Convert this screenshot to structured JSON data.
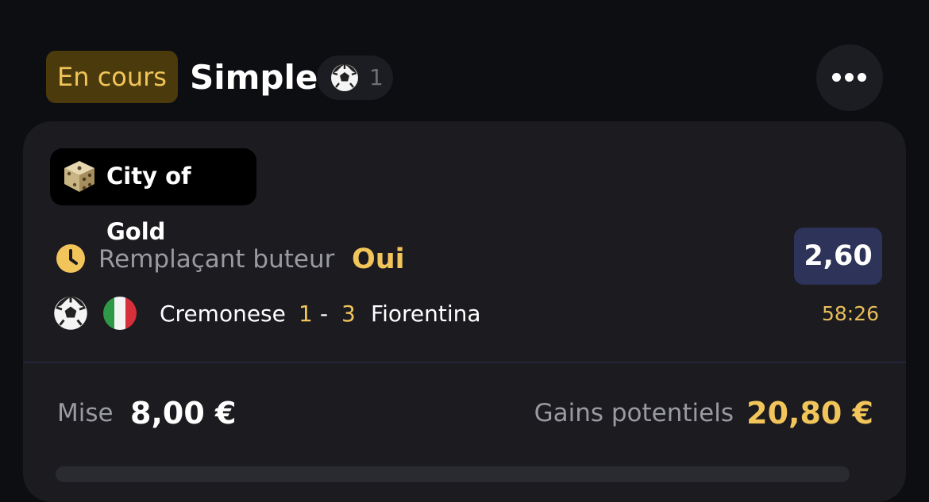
{
  "header": {
    "status": "En cours",
    "bet_type": "Simple",
    "selection_count": "1",
    "sport_icon": "soccer-ball-icon",
    "more_icon": "more-horizontal-icon"
  },
  "card": {
    "game": {
      "icon": "dice-icon",
      "name": "City of Gold"
    },
    "bet": {
      "status_icon": "clock-icon",
      "market": "Remplaçant buteur",
      "selection": "Oui",
      "odds": "2,60"
    },
    "match": {
      "sport_icon": "soccer-ball-icon",
      "country_icon": "italy-flag-icon",
      "home_team": "Cremonese",
      "home_score": "1",
      "separator": "-",
      "away_score": "3",
      "away_team": "Fiorentina",
      "time": "58:26"
    },
    "footer": {
      "stake_label": "Mise",
      "stake_value": "8,00 €",
      "gains_label": "Gains potentiels",
      "gains_value": "20,80 €"
    }
  },
  "colors": {
    "background": "#0d0e11",
    "card": "#1b1b20",
    "accent_gold": "#f2c55a",
    "status_badge_bg": "#4a3a0c",
    "odds_bg": "#2d3359"
  }
}
